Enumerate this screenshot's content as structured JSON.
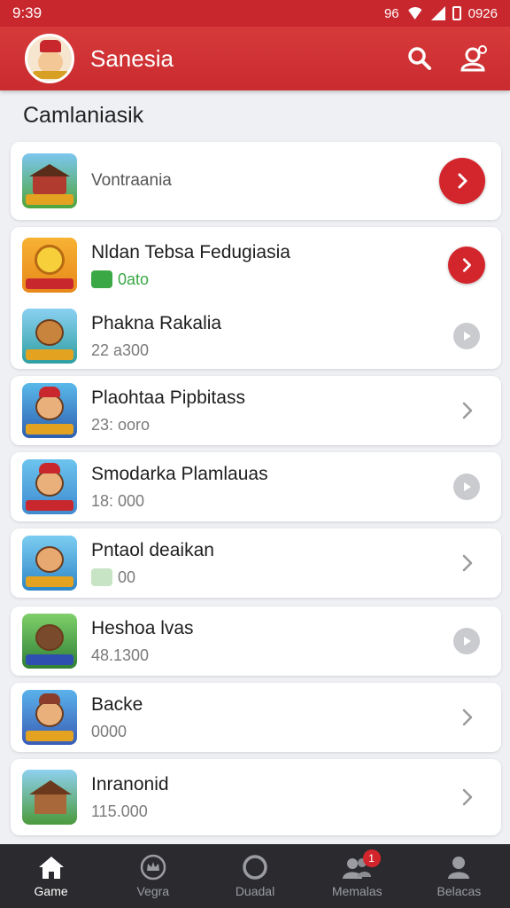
{
  "status_bar": {
    "time": "9:39",
    "battery_pct": "96",
    "clock_right": "0926"
  },
  "header": {
    "title": "Sanesia"
  },
  "section": {
    "title": "Camlaniasik"
  },
  "featured": {
    "title": "Vontraania"
  },
  "list": [
    {
      "title": "Nldan Tebsa Fedugiasia",
      "sub": "0ato",
      "sub_style": "green",
      "action": "red"
    },
    {
      "title": "Phakna Rakalia",
      "sub": "22 a300",
      "action": "play"
    },
    {
      "title": "Plaohtaa Pipbitass",
      "sub": "23: ooro",
      "action": "chevron"
    },
    {
      "title": "Smodarka Plamlauas",
      "sub": "18: 000",
      "action": "play"
    },
    {
      "title": "Pntaol deaikan",
      "sub": "00",
      "sub_style": "chip",
      "action": "chevron"
    },
    {
      "title": "Heshoa lvas",
      "sub": "48.1300",
      "action": "play"
    },
    {
      "title": "Backe",
      "sub": "0000",
      "sub_style": "chip",
      "action": "chevron"
    },
    {
      "title": "Inranonid",
      "sub": "115.000",
      "action": "chevron"
    }
  ],
  "nav": {
    "tabs": [
      {
        "label": "Game",
        "icon": "home-icon",
        "active": true
      },
      {
        "label": "Vegra",
        "icon": "crown-icon"
      },
      {
        "label": "Duadal",
        "icon": "circle-icon"
      },
      {
        "label": "Memalas",
        "icon": "people-icon",
        "badge": "1"
      },
      {
        "label": "Belacas",
        "icon": "person-icon"
      }
    ]
  },
  "colors": {
    "accent": "#c8272d",
    "nav_bg": "#2b2b2f",
    "bg": "#eef0f4"
  }
}
